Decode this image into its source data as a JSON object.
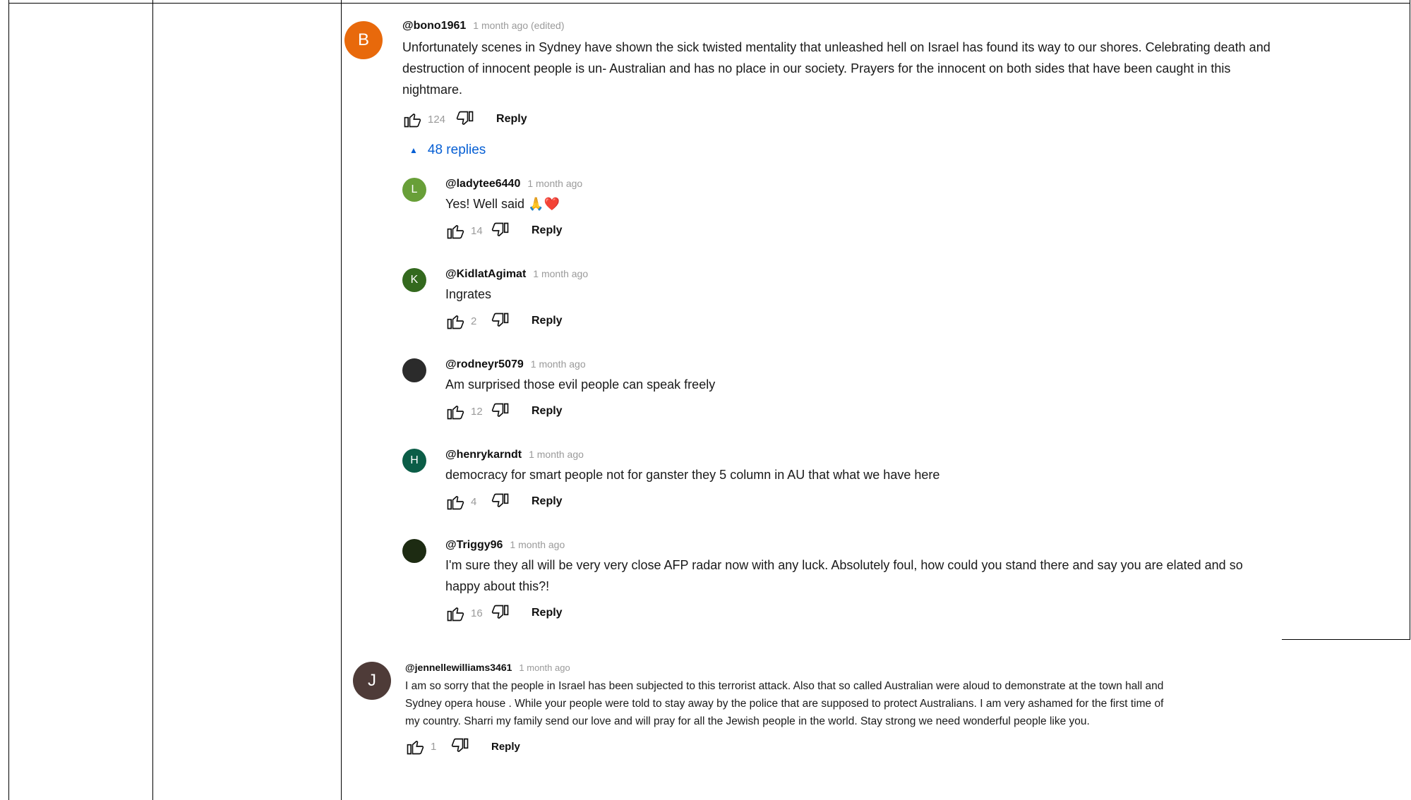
{
  "thread": {
    "top_comment": {
      "avatar_letter": "B",
      "avatar_color": "#e8690b",
      "handle": "@bono1961",
      "time": "1 month ago (edited)",
      "text": "Unfortunately scenes in Sydney have shown the sick twisted mentality that unleashed hell on Israel has found its way to our shores. Celebrating death and destruction of innocent people is un- Australian and has no place in our society. Prayers for the innocent on both sides that have been caught in this nightmare.",
      "likes": "124",
      "reply_label": "Reply"
    },
    "replies_toggle": {
      "label": "48 replies",
      "icon": "caret-up-icon"
    },
    "replies": [
      {
        "avatar_letter": "L",
        "avatar_color": "#689f38",
        "handle": "@ladytee6440",
        "time": "1 month ago",
        "text": "Yes! Well said 🙏❤️",
        "likes": "14",
        "reply_label": "Reply"
      },
      {
        "avatar_letter": "K",
        "avatar_color": "#33691e",
        "handle": "@KidlatAgimat",
        "time": "1 month ago",
        "text": "Ingrates",
        "likes": "2",
        "reply_label": "Reply"
      },
      {
        "avatar_letter": "",
        "avatar_color": "#2b2b2b",
        "handle": "@rodneyr5079",
        "time": "1 month ago",
        "text": "Am surprised those evil people can speak freely",
        "likes": "12",
        "reply_label": "Reply"
      },
      {
        "avatar_letter": "H",
        "avatar_color": "#0b5d47",
        "handle": "@henrykarndt",
        "time": "1 month ago",
        "text": "democracy for smart people not for ganster  they 5 column in AU  that what we  have here",
        "likes": "4",
        "reply_label": "Reply"
      },
      {
        "avatar_letter": "",
        "avatar_color": "#1d2b12",
        "handle": "@Triggy96",
        "time": "1 month ago",
        "text": "I'm sure they all will be very very close AFP radar now with any luck. Absolutely foul, how could you stand there and say you are elated and so happy about this?!",
        "likes": "16",
        "reply_label": "Reply"
      }
    ],
    "second_comment": {
      "avatar_letter": "J",
      "avatar_color": "#4e3b38",
      "handle": "@jennellewilliams3461",
      "time": "1 month ago",
      "text": "I am so sorry that the people in Israel has been subjected to this terrorist attack. Also that so called Australian were aloud to demonstrate at the town hall and Sydney opera  house . While your people were told to stay away by the police that are supposed to protect Australians. I am very ashamed for the first time of my country. Sharri my family send our love and will pray for all the Jewish people in the world. Stay strong we need wonderful people like you.",
      "likes": "1",
      "reply_label": "Reply"
    }
  }
}
